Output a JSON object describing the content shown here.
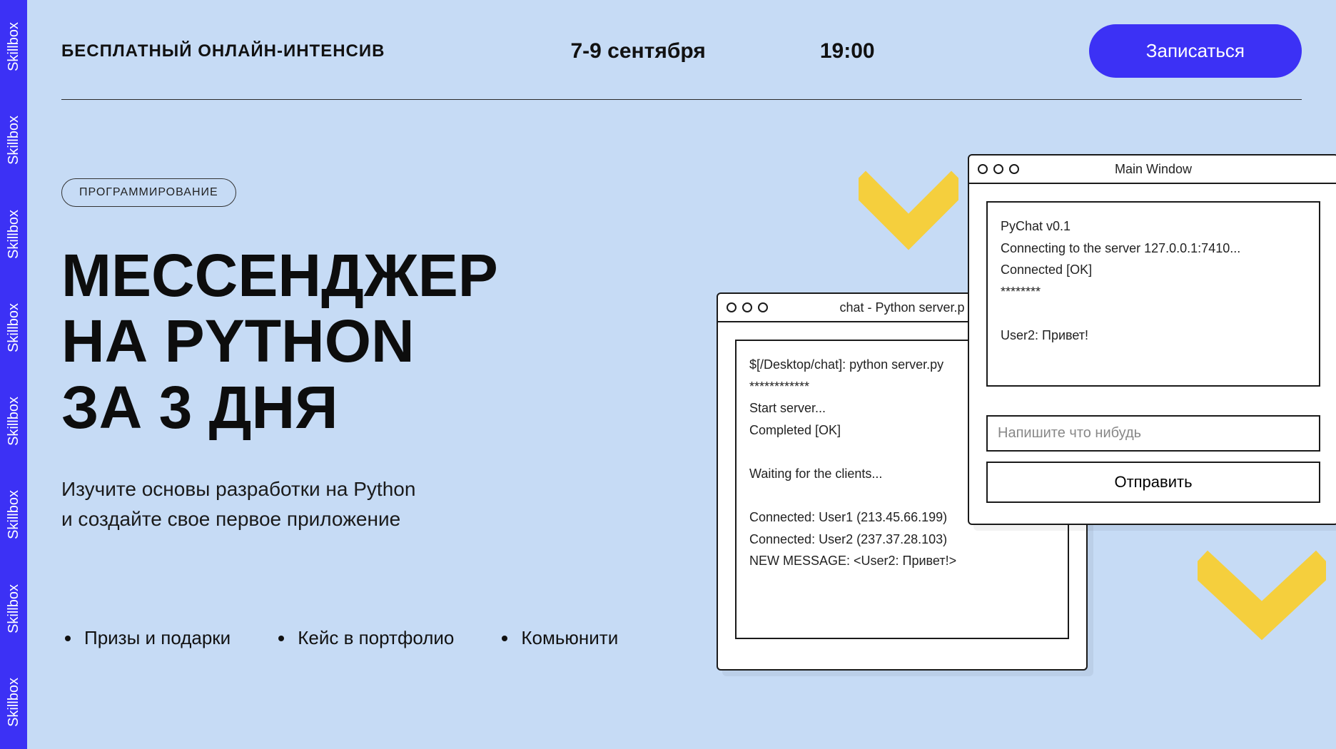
{
  "sidebar": {
    "brand": "Skillbox"
  },
  "header": {
    "label": "Бесплатный онлайн-интенсив",
    "dates": "7-9 сентября",
    "time": "19:00",
    "signup": "Записаться"
  },
  "hero": {
    "category": "Программирование",
    "title_line1": "Мессенджер",
    "title_line2": "на Python",
    "title_line3": "за 3 дня",
    "subtitle_line1": "Изучите основы разработки на Python",
    "subtitle_line2": "и создайте свое первое приложение",
    "bullets": [
      "Призы и подарки",
      "Кейс в портфолио",
      "Комьюнити"
    ]
  },
  "windows": {
    "server": {
      "title": "chat - Python server.p",
      "lines": [
        "$[/Desktop/chat]: python server.py",
        "************",
        "Start server...",
        "Completed [OK]",
        "",
        "Waiting for the clients...",
        "",
        "Connected: User1 (213.45.66.199)",
        "Connected: User2 (237.37.28.103)",
        "NEW MESSAGE: <User2: Привет!>"
      ]
    },
    "client": {
      "title": "Main Window",
      "lines": [
        "PyChat v0.1",
        "Connecting to the server 127.0.0.1:7410...",
        "Connected [OK]",
        "********",
        "",
        "User2: Привет!"
      ],
      "input_placeholder": "Напишите что нибудь",
      "send_label": "Отправить"
    }
  }
}
